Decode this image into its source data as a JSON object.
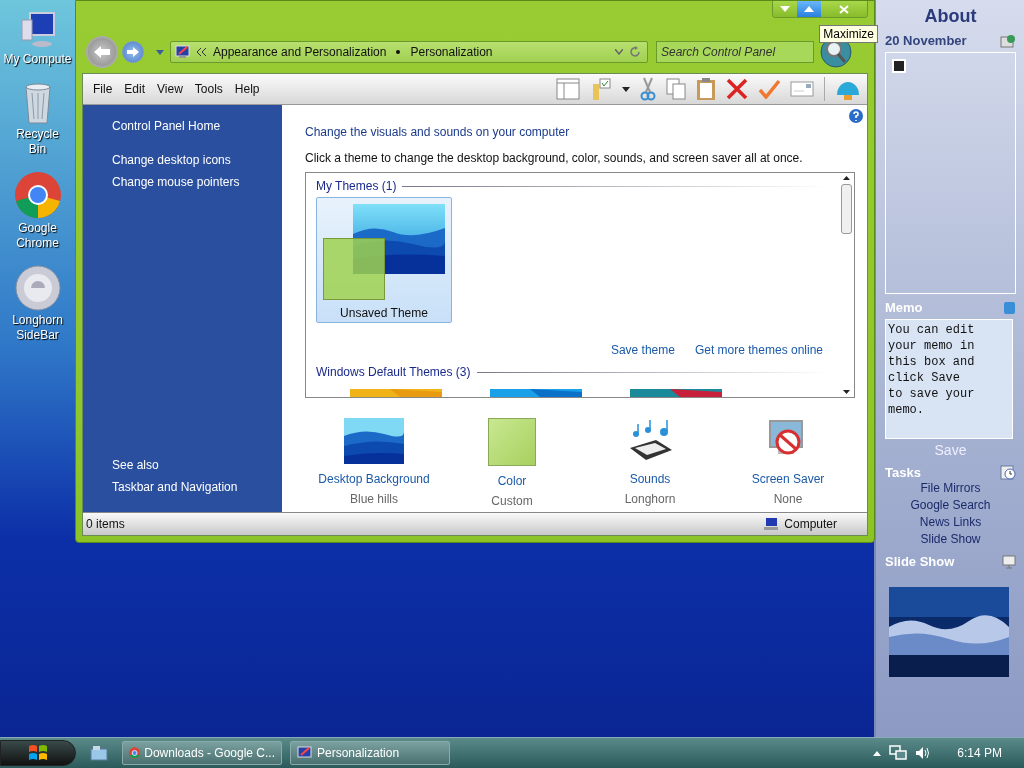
{
  "desktop_icons": [
    {
      "kind": "computer",
      "label": "My Compute"
    },
    {
      "kind": "bin",
      "label": "Recycle Bin"
    },
    {
      "kind": "chrome",
      "label": "Google Chrome"
    },
    {
      "kind": "sidebar",
      "label": "Longhorn SideBar"
    }
  ],
  "window": {
    "tooltip": "Maximize",
    "address": {
      "crumbs": [
        "Appearance and Personalization",
        "Personalization"
      ]
    },
    "search": {
      "placeholder": "Search Control Panel"
    },
    "menu": [
      "File",
      "Edit",
      "View",
      "Tools",
      "Help"
    ],
    "nav": {
      "links": [
        "Control Panel Home",
        "Change desktop icons",
        "Change mouse pointers"
      ],
      "see_also": "See also",
      "see_also_links": [
        "Taskbar and Navigation"
      ]
    },
    "heading": "Change the visuals and sounds on your computer",
    "description": "Click a theme to change the desktop background, color, sounds, and screen saver all at once.",
    "my_themes": {
      "label": "My Themes (1)",
      "items": [
        {
          "name": "Unsaved Theme",
          "selected": true
        }
      ]
    },
    "theme_links": [
      "Save theme",
      "Get more themes online"
    ],
    "default_themes": {
      "label": "Windows Default Themes (3)"
    },
    "settings": [
      {
        "kind": "background",
        "label": "Desktop Background",
        "value": "Blue hills"
      },
      {
        "kind": "color",
        "label": "Color",
        "value": "Custom"
      },
      {
        "kind": "sounds",
        "label": "Sounds",
        "value": "Longhorn"
      },
      {
        "kind": "screensaver",
        "label": "Screen Saver",
        "value": "None"
      }
    ],
    "status_bar": {
      "items": "0 items",
      "location": "Computer"
    }
  },
  "gadgets": {
    "title": "About",
    "date": "20 November",
    "memo_heading": "Memo",
    "memo": "You can edit your memo in this box and click Save to save your memo.",
    "save": "Save",
    "tasks_heading": "Tasks",
    "tasks": [
      "File Mirrors",
      "Google Search",
      "News Links",
      "Slide Show"
    ],
    "slideshow_heading": "Slide Show"
  },
  "taskbar": {
    "buttons": [
      {
        "kind": "chrome",
        "label": "Downloads - Google C..."
      },
      {
        "kind": "control",
        "label": "Personalization"
      }
    ],
    "clock": "6:14 PM"
  }
}
